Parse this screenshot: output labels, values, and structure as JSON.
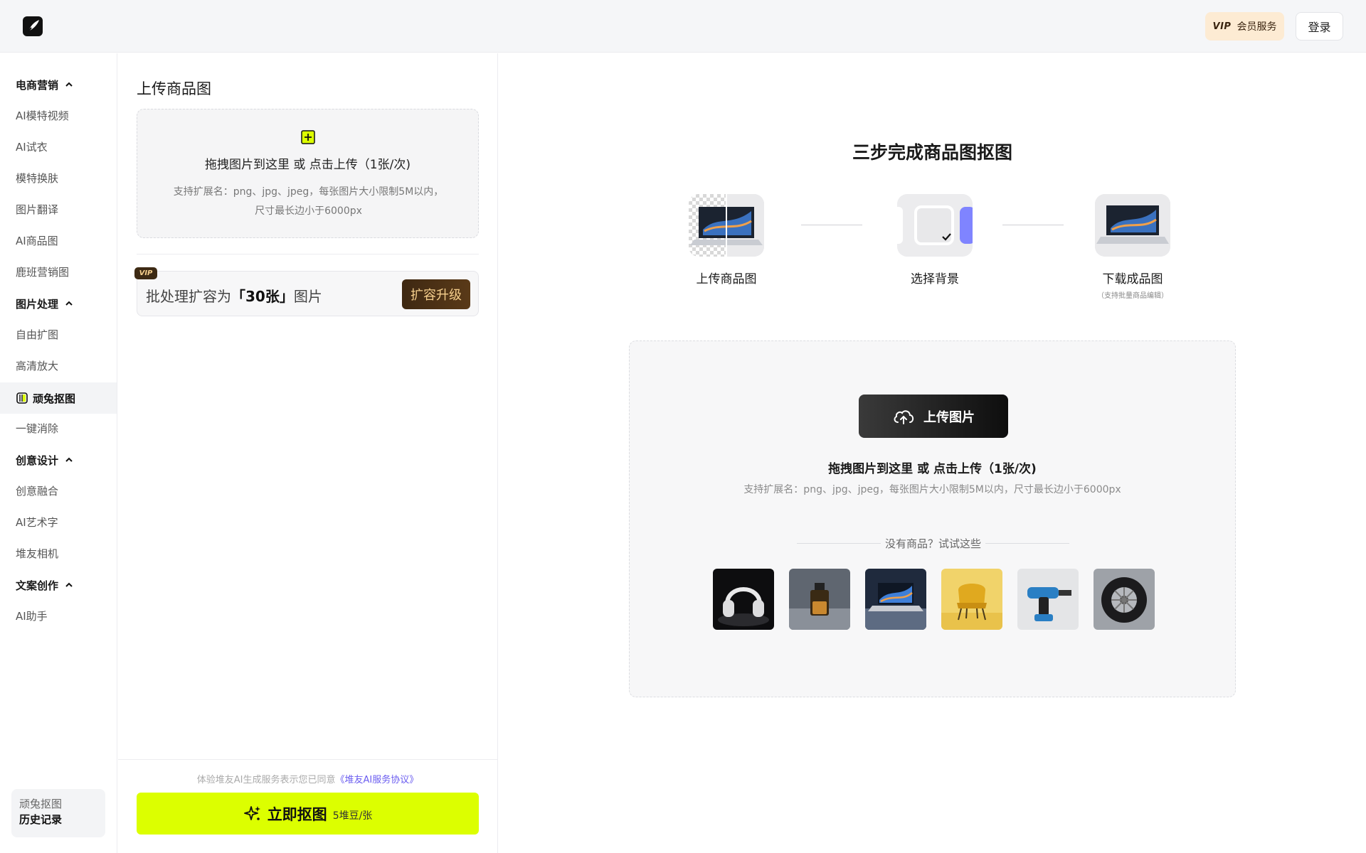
{
  "header": {
    "vip_tag": "VIP",
    "vip_label": "会员服务",
    "login_label": "登录"
  },
  "sidebar": {
    "groups": [
      {
        "label": "电商营销",
        "items": [
          "AI模特视频",
          "AI试衣",
          "模特换肤",
          "图片翻译",
          "AI商品图",
          "鹿班营销图"
        ]
      },
      {
        "label": "图片处理",
        "items": [
          "自由扩图",
          "高清放大",
          "顽兔抠图",
          "一键消除"
        ]
      },
      {
        "label": "创意设计",
        "items": [
          "创意融合",
          "AI艺术字",
          "堆友相机"
        ]
      },
      {
        "label": "文案创作",
        "items": [
          "AI助手"
        ]
      }
    ],
    "active_item": "顽兔抠图",
    "history": {
      "line1": "顽兔抠图",
      "line2": "历史记录"
    }
  },
  "panel": {
    "title": "上传商品图",
    "dropzone": {
      "main_text": "拖拽图片到这里 或 点击上传（1张/次)",
      "hint": "支持扩展名：png、jpg、jpeg，每张图片大小限制5M以内，尺寸最长边小于6000px"
    },
    "vip_banner": {
      "badge": "VIP",
      "prefix": "批处理扩容为",
      "highlight": "「30张」",
      "suffix": "图片",
      "button": "扩容升级"
    },
    "footer": {
      "agreement_prefix": "体验堆友AI生成服务表示您已同意",
      "agreement_link": "《堆友AI服务协议》",
      "action_label": "立即抠图",
      "action_cost": "5堆豆/张"
    }
  },
  "main": {
    "title": "三步完成商品图抠图",
    "steps": [
      {
        "label": "上传商品图",
        "sub": ""
      },
      {
        "label": "选择背景",
        "sub": ""
      },
      {
        "label": "下载成品图",
        "sub": "（支持批量商品编辑）"
      }
    ],
    "upload": {
      "button": "上传图片",
      "main_text": "拖拽图片到这里 或 点击上传（1张/次)",
      "hint": "支持扩展名：png、jpg、jpeg，每张图片大小限制5M以内，尺寸最长边小于6000px",
      "try_text": "没有商品？试试这些"
    },
    "samples": [
      "headphones",
      "perfume",
      "laptop",
      "chair",
      "drill",
      "tire"
    ]
  },
  "colors": {
    "accent_lime": "#dcff00",
    "vip_gold": "#f6cf8d",
    "vip_brown": "#3e2812",
    "link_purple": "#6a5cf0"
  }
}
